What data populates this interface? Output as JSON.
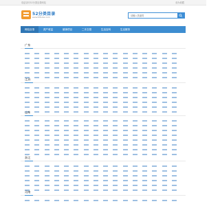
{
  "topbar": {
    "welcome": "欢迎访问52分类目录网站",
    "favorite": "设为收藏"
  },
  "logo": {
    "title": "52分类目录",
    "subtitle": "www.52fenlei.com"
  },
  "search": {
    "placeholder": "请输入关键词"
  },
  "nav": {
    "items": [
      "网站目录",
      "资产收益",
      "营销项目",
      "二手交易",
      "生活百科",
      "生活服务"
    ]
  },
  "sections": [
    {
      "title": "广东",
      "rows": 6,
      "cols": 16
    },
    {
      "title": "江苏",
      "rows": 6,
      "cols": 16
    },
    {
      "title": "山东",
      "rows": 8,
      "cols": 16
    },
    {
      "title": "浙江",
      "rows": 6,
      "cols": 16
    },
    {
      "title": "河南",
      "rows": 1,
      "cols": 16
    }
  ],
  "colors": {
    "accent": "#3d8dd1",
    "link": "#2a6cbc"
  }
}
